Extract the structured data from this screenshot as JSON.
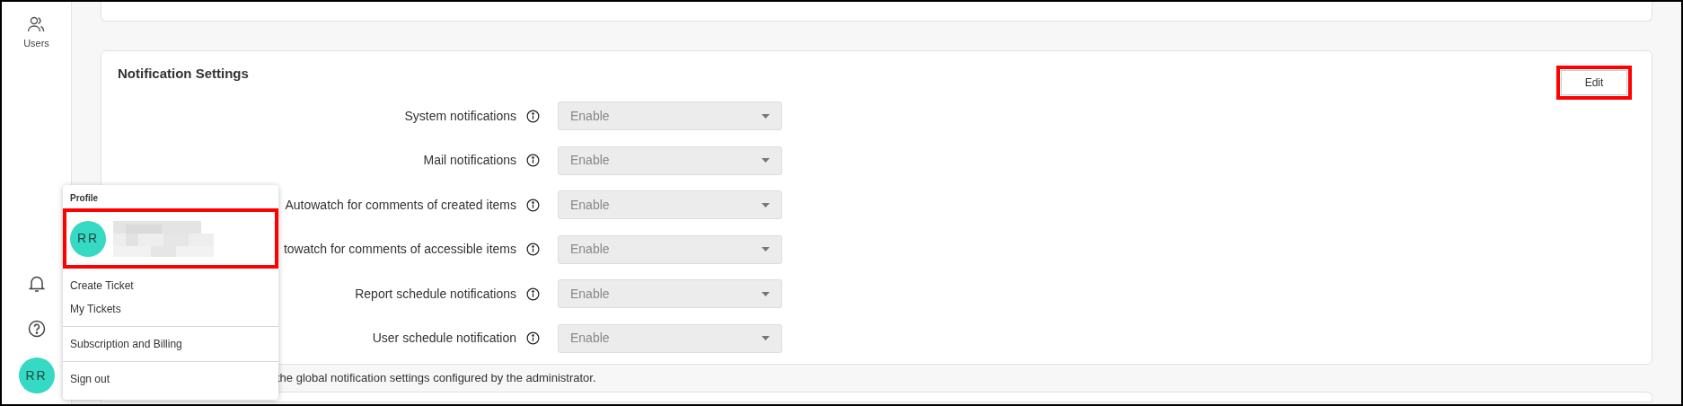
{
  "sidebar": {
    "items": [
      {
        "label": "Users"
      }
    ],
    "avatar": "RR"
  },
  "card": {
    "title": "Notification Settings",
    "edit_button": "Edit",
    "settings": [
      {
        "label": "System notifications",
        "value": "Enable"
      },
      {
        "label": "Mail notifications",
        "value": "Enable"
      },
      {
        "label": "Autowatch for comments of created items",
        "value": "Enable"
      },
      {
        "label": "towatch for comments of accessible items",
        "value": "Enable"
      },
      {
        "label": "Report schedule notifications",
        "value": "Enable"
      },
      {
        "label": "User schedule notification",
        "value": "Enable"
      }
    ],
    "disabled": true,
    "footnote": "the global notification settings configured by the administrator."
  },
  "profile_menu": {
    "heading": "Profile",
    "avatar": "RR",
    "groups": [
      [
        "Create Ticket",
        "My Tickets"
      ],
      [
        "Subscription and Billing"
      ],
      [
        "Sign out"
      ]
    ]
  }
}
